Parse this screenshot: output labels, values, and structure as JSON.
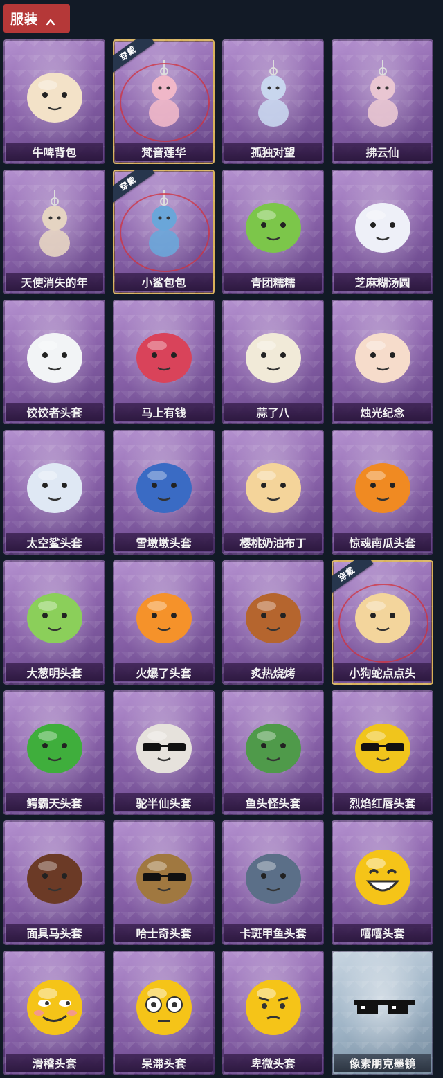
{
  "header": {
    "tab_label": "服装",
    "tab_icon": "chevron-up-icon",
    "accent_color": "#b53838"
  },
  "worn_badge_text": "穿戴",
  "items": [
    {
      "name": "牛啤背包",
      "icon": "cow-beer-barrel-backpack",
      "worn": false,
      "color": "#f3e2c8"
    },
    {
      "name": "梵音莲华",
      "icon": "lotus-girl-figure",
      "worn": true,
      "color": "#f0b7c8"
    },
    {
      "name": "孤独对望",
      "icon": "hanging-figure-charm",
      "worn": false,
      "color": "#c8d6ee"
    },
    {
      "name": "拂云仙",
      "icon": "hanging-fairy-charm",
      "worn": false,
      "color": "#e9c6d2"
    },
    {
      "name": "天使消失的年",
      "icon": "angel-doll-charm",
      "worn": false,
      "color": "#e5d4c2"
    },
    {
      "name": "小鲨包包",
      "icon": "shark-bag-charm",
      "worn": true,
      "color": "#6aa6d9"
    },
    {
      "name": "青团糯糯",
      "icon": "green-rice-ball",
      "worn": false,
      "color": "#7cc64a"
    },
    {
      "name": "芝麻糊汤圆",
      "icon": "white-dumpling",
      "worn": false,
      "color": "#eef0f8"
    },
    {
      "name": "饺饺者头套",
      "icon": "dumpling-head",
      "worn": false,
      "color": "#f2f4f6"
    },
    {
      "name": "马上有钱",
      "icon": "red-horse-head",
      "worn": false,
      "color": "#d9435a"
    },
    {
      "name": "蒜了八",
      "icon": "garlic-head",
      "worn": false,
      "color": "#f1ead8"
    },
    {
      "name": "烛光纪念",
      "icon": "candle-head",
      "worn": false,
      "color": "#f6dccb"
    },
    {
      "name": "太空鲨头套",
      "icon": "space-shark-head",
      "worn": false,
      "color": "#dfe8f4"
    },
    {
      "name": "雪墩墩头套",
      "icon": "snowman-hat-head",
      "worn": false,
      "color": "#3a6bc4"
    },
    {
      "name": "樱桃奶油布丁",
      "icon": "pudding-head",
      "worn": false,
      "color": "#f4d49a"
    },
    {
      "name": "惊魂南瓜头套",
      "icon": "pumpkin-head",
      "worn": false,
      "color": "#f08a22"
    },
    {
      "name": "大葱明头套",
      "icon": "scallion-head",
      "worn": false,
      "color": "#8bcf5a"
    },
    {
      "name": "火爆了头套",
      "icon": "fire-head",
      "worn": false,
      "color": "#f5922a"
    },
    {
      "name": "炙热烧烤",
      "icon": "bbq-meat-head",
      "worn": false,
      "color": "#b5652e"
    },
    {
      "name": "小狗蛇点点头",
      "icon": "puppy-snake-head",
      "worn": true,
      "color": "#f3d59c"
    },
    {
      "name": "鳄霸天头套",
      "icon": "crocodile-head",
      "worn": false,
      "color": "#3fae3c"
    },
    {
      "name": "驼半仙头套",
      "icon": "alpaca-sunglasses-head",
      "worn": false,
      "color": "#e6e2dc"
    },
    {
      "name": "鱼头怪头套",
      "icon": "fish-head-mask",
      "worn": false,
      "color": "#4f9a4a"
    },
    {
      "name": "烈焰红唇头套",
      "icon": "pikachu-sunglasses-head",
      "worn": false,
      "color": "#f0c51c"
    },
    {
      "name": "面具马头套",
      "icon": "horse-mask-head",
      "worn": false,
      "color": "#6b3a26"
    },
    {
      "name": "哈士奇头套",
      "icon": "husky-sunglasses-head",
      "worn": false,
      "color": "#a07840"
    },
    {
      "name": "卡斑甲鱼头套",
      "icon": "turtle-fish-head",
      "worn": false,
      "color": "#5b6f88"
    },
    {
      "name": "嘻嘻头套",
      "icon": "grin-emoji-head",
      "worn": false,
      "color": "#f5c418"
    },
    {
      "name": "滑稽头套",
      "icon": "smirk-emoji-head",
      "worn": false,
      "color": "#f5c418"
    },
    {
      "name": "呆滞头套",
      "icon": "dazed-emoji-head",
      "worn": false,
      "color": "#f5c418"
    },
    {
      "name": "卑微头套",
      "icon": "humble-emoji-head",
      "worn": false,
      "color": "#f5c418"
    },
    {
      "name": "像素朋克墨镜",
      "icon": "pixel-sunglasses",
      "worn": false,
      "color": "#111111",
      "silver": true
    }
  ]
}
